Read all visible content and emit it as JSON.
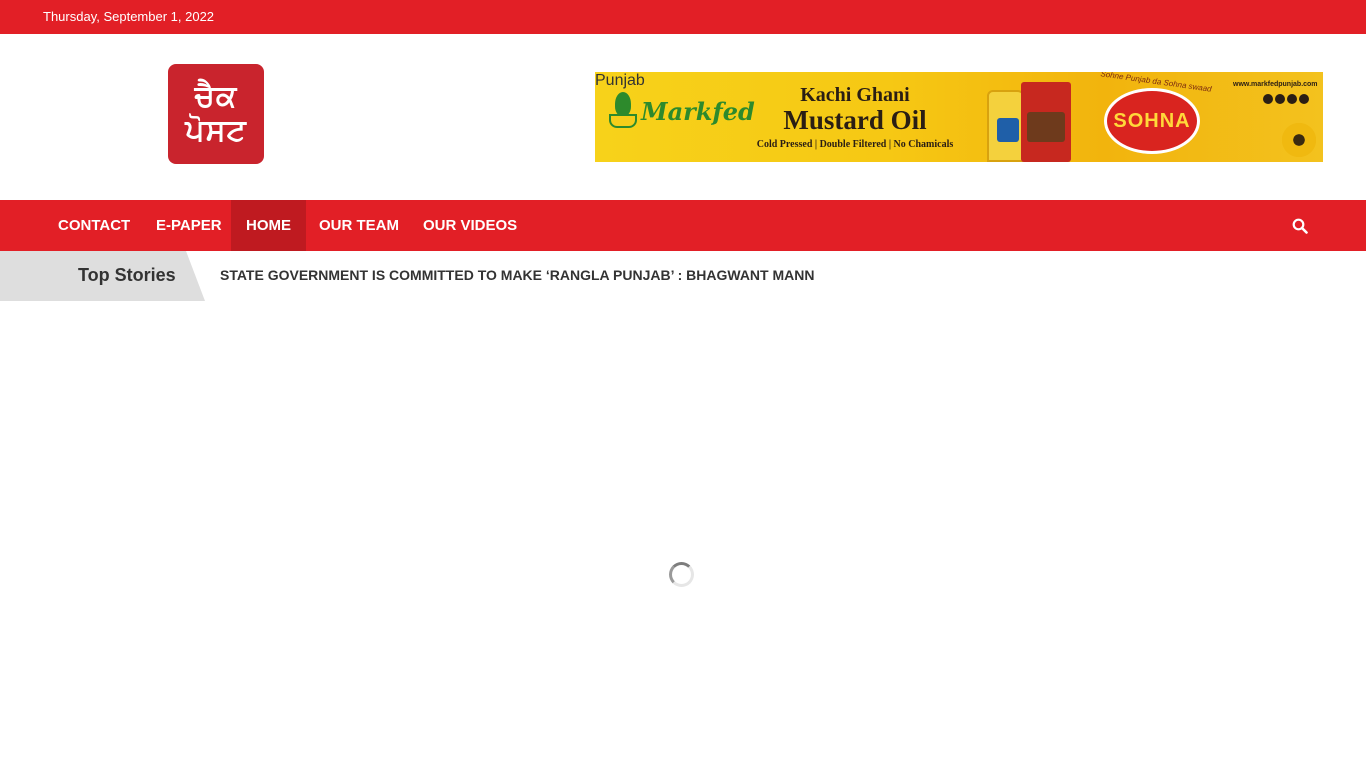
{
  "topbar": {
    "date": "Thursday, September 1, 2022"
  },
  "logo": {
    "line1": "ਚੈਕ",
    "line2": "ਪੋਸਟ"
  },
  "ad": {
    "brand": "Markfed",
    "brand_sub": "Punjab",
    "line1": "Kachi Ghani",
    "line2": "Mustard Oil",
    "line3": "Cold Pressed | Double Filtered | No Chamicals",
    "tagline": "Sohne Punjab da Sohna swaad",
    "product": "SOHNA",
    "website": "www.markfedpunjab.com"
  },
  "nav": {
    "items": [
      {
        "label": "CONTACT"
      },
      {
        "label": "E-PAPER"
      },
      {
        "label": "HOME",
        "active": true
      },
      {
        "label": "OUR TEAM"
      },
      {
        "label": "OUR VIDEOS"
      }
    ],
    "search_icon": "search-icon"
  },
  "ticker": {
    "label": "Top Stories",
    "headline": "STATE GOVERNMENT IS COMMITTED TO MAKE ‘RANGLA PUNJAB’ : BHAGWANT MANN"
  },
  "colors": {
    "brand_red": "#e21f26",
    "active_red": "#bf1a20",
    "ticker_gray": "#dedede"
  }
}
